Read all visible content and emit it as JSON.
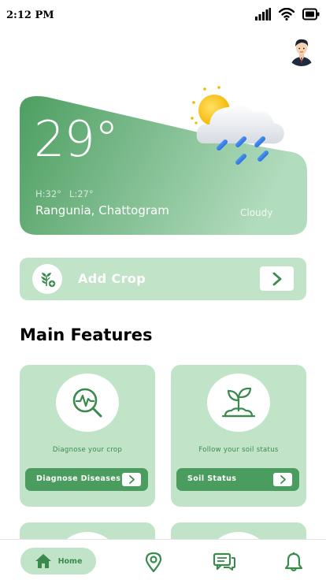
{
  "status_bar": {
    "time": "2:12 PM"
  },
  "weather": {
    "temperature": "29°",
    "high": "H:32°",
    "low": "L:27°",
    "location": "Rangunia, Chattogram",
    "condition": "Cloudy"
  },
  "add_crop": {
    "label": "Add Crop"
  },
  "section": {
    "title": "Main Features"
  },
  "features": [
    {
      "caption": "Diagnose your crop",
      "action_label": "Diagnose Diseases"
    },
    {
      "caption": "Follow your soil status",
      "action_label": "Soil Status"
    }
  ],
  "bottom_nav": {
    "home_label": "Home",
    "items": [
      "home-icon",
      "location-pin-icon",
      "chat-icon",
      "bell-icon"
    ]
  },
  "colors": {
    "accent": "#4b9d5f",
    "card": "#c1e4c8",
    "weather_gradient_start": "#4d9e61",
    "weather_gradient_end": "#b2dcbe"
  }
}
